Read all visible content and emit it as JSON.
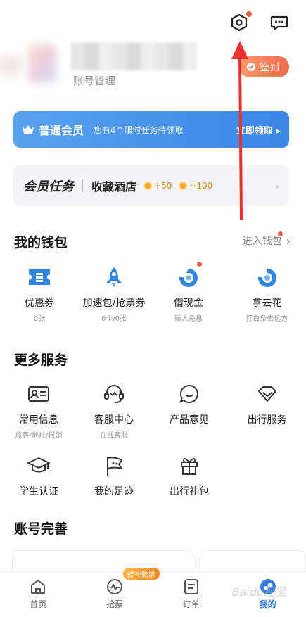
{
  "header": {
    "settings_icon": "settings-hex-icon",
    "message_icon": "message-icon"
  },
  "profile": {
    "account_management": "账号管理",
    "signin_label": "签到"
  },
  "member_banner": {
    "title": "普通会员",
    "desc": "您有4个限时任务待领取",
    "claim": "立即领取"
  },
  "task_card": {
    "title": "会员任务",
    "task_name": "收藏酒店",
    "reward1": "+50",
    "reward2": "+100"
  },
  "wallet": {
    "title": "我的钱包",
    "link": "进入钱包",
    "items": [
      {
        "label": "优惠券",
        "sub": "0张"
      },
      {
        "label": "加速包/抢票券",
        "sub": "0个/0张"
      },
      {
        "label": "借现金",
        "sub": "新人免息"
      },
      {
        "label": "拿去花",
        "sub": "打白条去远方"
      }
    ]
  },
  "services": {
    "title": "更多服务",
    "row1": [
      {
        "label": "常用信息",
        "sub": "旅客/地址/报销"
      },
      {
        "label": "客服中心",
        "sub": "在线客服"
      },
      {
        "label": "产品意见",
        "sub": ""
      },
      {
        "label": "出行服务",
        "sub": ""
      }
    ],
    "row2": [
      {
        "label": "学生认证"
      },
      {
        "label": "我的足迹"
      },
      {
        "label": "出行礼包"
      }
    ]
  },
  "account": {
    "title": "账号完善"
  },
  "tabbar": {
    "tabs": [
      {
        "label": "首页"
      },
      {
        "label": "抢票",
        "badge": "候补抢票"
      },
      {
        "label": "订单"
      },
      {
        "label": "我的"
      }
    ]
  },
  "watermark": "Baidu经验",
  "colors": {
    "accent": "#2f7de1",
    "red": "#f25c4b",
    "orange": "#f08a24"
  }
}
